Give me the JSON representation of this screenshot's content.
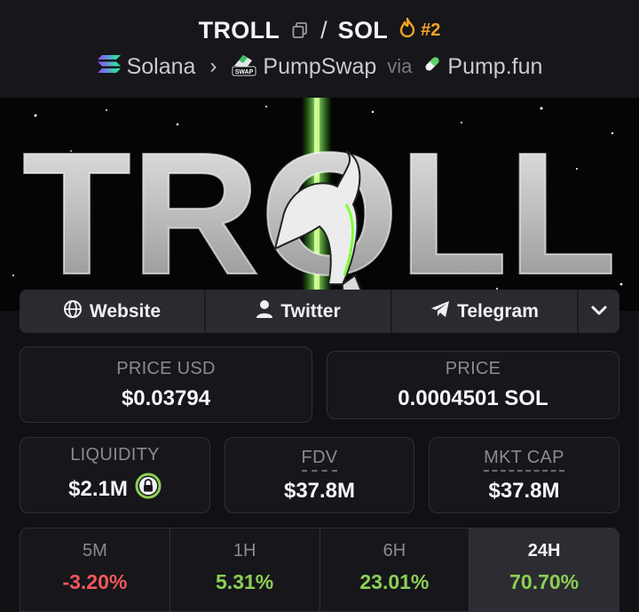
{
  "header": {
    "token_symbol": "TROLL",
    "separator": "/",
    "quote_symbol": "SOL",
    "rank": "#2",
    "chain": "Solana",
    "dex": "PumpSwap",
    "via_label": "via",
    "launchpad": "Pump.fun",
    "dex_badge_text": "SWAP"
  },
  "banner": {
    "text": "TROLL"
  },
  "links": {
    "website": "Website",
    "twitter": "Twitter",
    "telegram": "Telegram"
  },
  "stats": {
    "price_usd_label": "PRICE USD",
    "price_usd": "$0.03794",
    "price_label": "PRICE",
    "price": "0.0004501 SOL",
    "liquidity_label": "LIQUIDITY",
    "liquidity": "$2.1M",
    "fdv_label": "FDV",
    "fdv": "$37.8M",
    "mcap_label": "MKT CAP",
    "mcap": "$37.8M"
  },
  "changes": [
    {
      "label": "5M",
      "value": "-3.20%",
      "direction": "down"
    },
    {
      "label": "1H",
      "value": "5.31%",
      "direction": "up"
    },
    {
      "label": "6H",
      "value": "23.01%",
      "direction": "up"
    },
    {
      "label": "24H",
      "value": "70.70%",
      "direction": "up",
      "active": true
    }
  ],
  "colors": {
    "background": "#111115",
    "accent_fire": "#f5a524",
    "negative": "#f0585c",
    "positive": "#8ccf55",
    "banner_beam": "#7cff3a"
  },
  "icons": [
    "copy-icon",
    "fire-icon",
    "solana-icon",
    "pumpswap-icon",
    "pill-icon",
    "globe-icon",
    "user-icon",
    "telegram-icon",
    "chevron-down-icon",
    "lock-icon"
  ]
}
